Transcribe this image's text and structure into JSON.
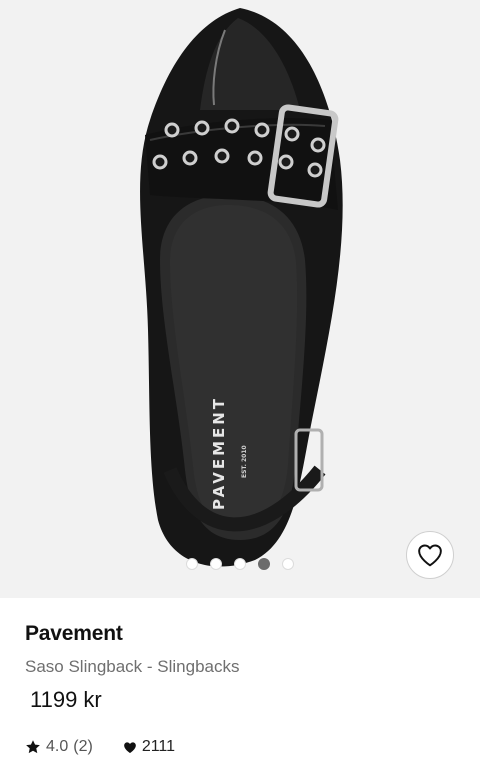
{
  "product": {
    "brand": "Pavement",
    "title": "Saso Slingback - Slingbacks",
    "price": "1199 kr",
    "rating": "4.0",
    "rating_count": "(2)",
    "favorites": "2111",
    "image_logo_text": "PAVEMENT",
    "image_logo_sub": "EST. 2010"
  },
  "carousel": {
    "dot_count": 5,
    "active_index": 3
  },
  "icons": {
    "favorite": "heart-outline-icon",
    "rating": "star-icon",
    "favorites_count": "heart-filled-icon"
  }
}
